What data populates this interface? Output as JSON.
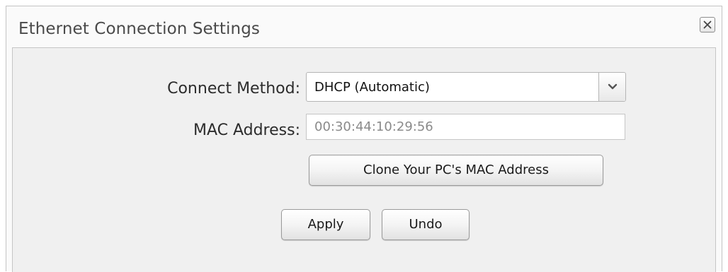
{
  "dialog": {
    "title": "Ethernet Connection Settings",
    "close_icon": "close-x-icon"
  },
  "form": {
    "connect_method": {
      "label": "Connect Method:",
      "selected": "DHCP (Automatic)",
      "dropdown_icon": "chevron-down-icon"
    },
    "mac_address": {
      "label": "MAC Address:",
      "value": "00:30:44:10:29:56"
    },
    "clone_button_label": "Clone Your PC's MAC Address"
  },
  "actions": {
    "apply_label": "Apply",
    "undo_label": "Undo"
  }
}
